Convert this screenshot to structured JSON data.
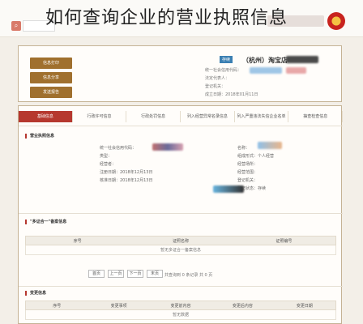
{
  "title": "如何查询企业的营业执照信息",
  "header": {
    "status": "存续",
    "company_name": "（杭州）淘宝店",
    "buttons": [
      "信息打印",
      "信息分享",
      "发送报告"
    ],
    "lines": [
      "统一社会信用代码：",
      "法定代表人：",
      "登记机关：",
      "成立日期：2018年01月11日"
    ]
  },
  "tabs": [
    "基础信息",
    "行政许可信息",
    "行政处罚信息",
    "列入经营异常名录信息",
    "列入严重违法失信企业名单",
    "抽查检查信息"
  ],
  "basic_section": {
    "title": "营业执照信息",
    "fields_left": [
      "统一社会信用代码：",
      "类型：",
      "经营者：",
      "注册日期：2018年12月13日",
      "核准日期：2018年12月13日"
    ],
    "fields_right": [
      "名称：",
      "组成形式：个人经营",
      "经营场所：",
      "经营范围：",
      "登记机关：",
      "登记状态：存续"
    ]
  },
  "license_section": {
    "title": "\"多证合一\"备案信息",
    "columns": [
      "序号",
      "证照名称",
      "证照编号"
    ],
    "empty_text": "暂无多证合一备案信息"
  },
  "pager": {
    "buttons": [
      "首页",
      "上一页",
      "下一页",
      "末页"
    ],
    "text": "共查询到 0 条记录 共 0 页"
  },
  "change_section": {
    "title": "变更信息",
    "columns": [
      "序号",
      "变更事项",
      "变更前内容",
      "变更后内容",
      "变更日期"
    ],
    "empty_text": "暂无数据"
  }
}
